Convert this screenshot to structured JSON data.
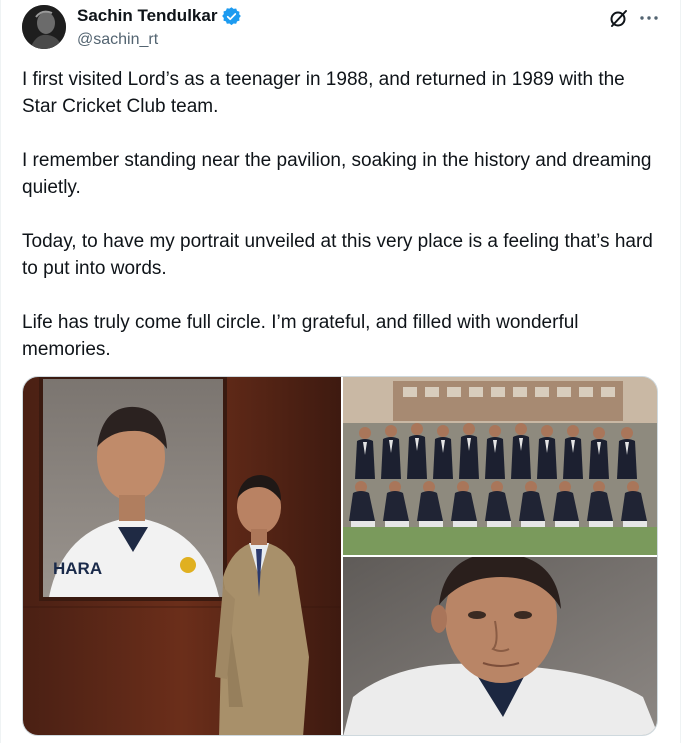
{
  "author": {
    "name": "Sachin Tendulkar",
    "handle": "@sachin_rt",
    "verified": true
  },
  "tweet": {
    "paragraphs": [
      "I first visited Lord’s as a teenager in 1988, and returned in 1989 with the Star Cricket Club team.",
      "I remember standing near the pavilion, soaking in the history and dreaming quietly.",
      "Today, to have my portrait unveiled at this very place is a feeling that’s hard to put into words.",
      "Life has truly come full circle. I’m grateful, and filled with wonderful memories."
    ]
  },
  "portrait_jersey_text": "HARA",
  "colors": {
    "text": "#0f1419",
    "secondary": "#536471",
    "verified": "#1d9bf0",
    "border": "#cfd9de"
  },
  "icons": [
    "verified-badge-icon",
    "grok-icon",
    "more-icon"
  ]
}
